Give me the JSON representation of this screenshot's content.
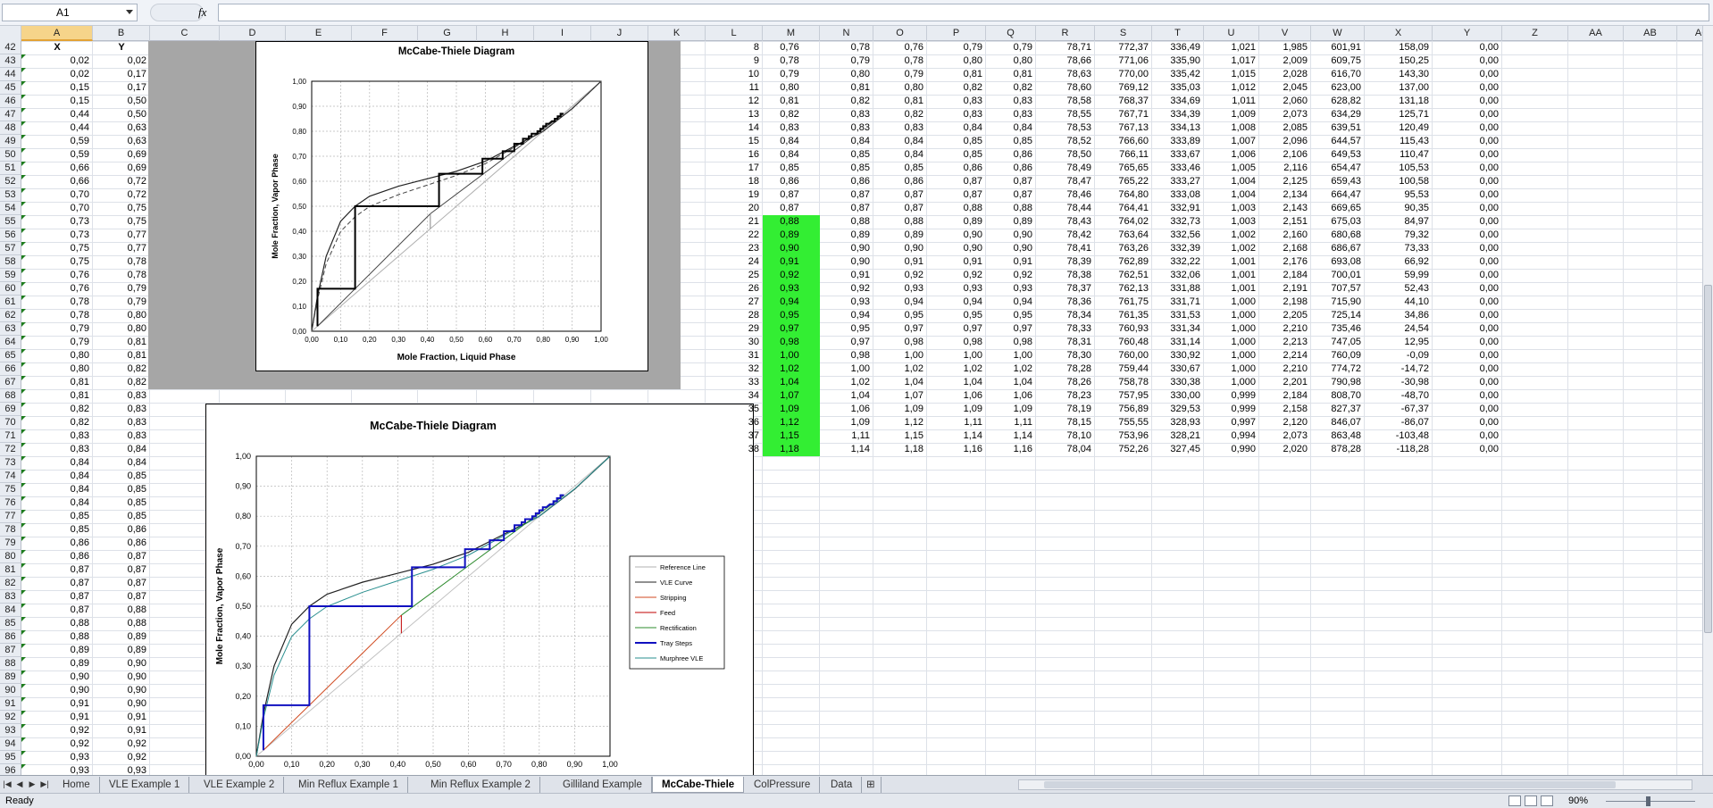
{
  "name_box": "A1",
  "fx": "fx",
  "columns": [
    "A",
    "B",
    "C",
    "D",
    "E",
    "F",
    "G",
    "H",
    "I",
    "J",
    "K",
    "L",
    "M",
    "N",
    "O",
    "P",
    "Q",
    "R",
    "S",
    "T",
    "U",
    "V",
    "W",
    "X",
    "Y",
    "Z",
    "AA",
    "AB",
    "AC"
  ],
  "selected_column": "A",
  "rows_first": 42,
  "header_row": {
    "A": "X",
    "B": "Y"
  },
  "xy": [
    [
      "0,02",
      "0,02"
    ],
    [
      "0,02",
      "0,17"
    ],
    [
      "0,15",
      "0,17"
    ],
    [
      "0,15",
      "0,50"
    ],
    [
      "0,44",
      "0,50"
    ],
    [
      "0,44",
      "0,63"
    ],
    [
      "0,59",
      "0,63"
    ],
    [
      "0,59",
      "0,69"
    ],
    [
      "0,66",
      "0,69"
    ],
    [
      "0,66",
      "0,72"
    ],
    [
      "0,70",
      "0,72"
    ],
    [
      "0,70",
      "0,75"
    ],
    [
      "0,73",
      "0,75"
    ],
    [
      "0,73",
      "0,77"
    ],
    [
      "0,75",
      "0,77"
    ],
    [
      "0,75",
      "0,78"
    ],
    [
      "0,76",
      "0,78"
    ],
    [
      "0,76",
      "0,79"
    ],
    [
      "0,78",
      "0,79"
    ],
    [
      "0,78",
      "0,80"
    ],
    [
      "0,79",
      "0,80"
    ],
    [
      "0,79",
      "0,81"
    ],
    [
      "0,80",
      "0,81"
    ],
    [
      "0,80",
      "0,82"
    ],
    [
      "0,81",
      "0,82"
    ],
    [
      "0,81",
      "0,83"
    ],
    [
      "0,82",
      "0,83"
    ],
    [
      "0,82",
      "0,83"
    ],
    [
      "0,83",
      "0,83"
    ],
    [
      "0,83",
      "0,84"
    ],
    [
      "0,84",
      "0,84"
    ],
    [
      "0,84",
      "0,85"
    ],
    [
      "0,84",
      "0,85"
    ],
    [
      "0,84",
      "0,85"
    ],
    [
      "0,85",
      "0,85"
    ],
    [
      "0,85",
      "0,86"
    ],
    [
      "0,86",
      "0,86"
    ],
    [
      "0,86",
      "0,87"
    ],
    [
      "0,87",
      "0,87"
    ],
    [
      "0,87",
      "0,87"
    ],
    [
      "0,87",
      "0,87"
    ],
    [
      "0,87",
      "0,88"
    ],
    [
      "0,88",
      "0,88"
    ],
    [
      "0,88",
      "0,89"
    ],
    [
      "0,89",
      "0,89"
    ],
    [
      "0,89",
      "0,90"
    ],
    [
      "0,90",
      "0,90"
    ],
    [
      "0,90",
      "0,90"
    ],
    [
      "0,91",
      "0,90"
    ],
    [
      "0,91",
      "0,91"
    ],
    [
      "0,92",
      "0,91"
    ],
    [
      "0,92",
      "0,92"
    ],
    [
      "0,93",
      "0,92"
    ],
    [
      "0,93",
      "0,93"
    ]
  ],
  "table": [
    [
      "8",
      "0,76",
      "0,78",
      "0,76",
      "0,79",
      "0,79",
      "78,71",
      "772,37",
      "336,49",
      "1,021",
      "1,985",
      "601,91",
      "158,09",
      "0,00"
    ],
    [
      "9",
      "0,78",
      "0,79",
      "0,78",
      "0,80",
      "0,80",
      "78,66",
      "771,06",
      "335,90",
      "1,017",
      "2,009",
      "609,75",
      "150,25",
      "0,00"
    ],
    [
      "10",
      "0,79",
      "0,80",
      "0,79",
      "0,81",
      "0,81",
      "78,63",
      "770,00",
      "335,42",
      "1,015",
      "2,028",
      "616,70",
      "143,30",
      "0,00"
    ],
    [
      "11",
      "0,80",
      "0,81",
      "0,80",
      "0,82",
      "0,82",
      "78,60",
      "769,12",
      "335,03",
      "1,012",
      "2,045",
      "623,00",
      "137,00",
      "0,00"
    ],
    [
      "12",
      "0,81",
      "0,82",
      "0,81",
      "0,83",
      "0,83",
      "78,58",
      "768,37",
      "334,69",
      "1,011",
      "2,060",
      "628,82",
      "131,18",
      "0,00"
    ],
    [
      "13",
      "0,82",
      "0,83",
      "0,82",
      "0,83",
      "0,83",
      "78,55",
      "767,71",
      "334,39",
      "1,009",
      "2,073",
      "634,29",
      "125,71",
      "0,00"
    ],
    [
      "14",
      "0,83",
      "0,83",
      "0,83",
      "0,84",
      "0,84",
      "78,53",
      "767,13",
      "334,13",
      "1,008",
      "2,085",
      "639,51",
      "120,49",
      "0,00"
    ],
    [
      "15",
      "0,84",
      "0,84",
      "0,84",
      "0,85",
      "0,85",
      "78,52",
      "766,60",
      "333,89",
      "1,007",
      "2,096",
      "644,57",
      "115,43",
      "0,00"
    ],
    [
      "16",
      "0,84",
      "0,85",
      "0,84",
      "0,85",
      "0,86",
      "78,50",
      "766,11",
      "333,67",
      "1,006",
      "2,106",
      "649,53",
      "110,47",
      "0,00"
    ],
    [
      "17",
      "0,85",
      "0,85",
      "0,85",
      "0,86",
      "0,86",
      "78,49",
      "765,65",
      "333,46",
      "1,005",
      "2,116",
      "654,47",
      "105,53",
      "0,00"
    ],
    [
      "18",
      "0,86",
      "0,86",
      "0,86",
      "0,87",
      "0,87",
      "78,47",
      "765,22",
      "333,27",
      "1,004",
      "2,125",
      "659,43",
      "100,58",
      "0,00"
    ],
    [
      "19",
      "0,87",
      "0,87",
      "0,87",
      "0,87",
      "0,87",
      "78,46",
      "764,80",
      "333,08",
      "1,004",
      "2,134",
      "664,47",
      "95,53",
      "0,00"
    ],
    [
      "20",
      "0,87",
      "0,87",
      "0,87",
      "0,88",
      "0,88",
      "78,44",
      "764,41",
      "332,91",
      "1,003",
      "2,143",
      "669,65",
      "90,35",
      "0,00"
    ],
    [
      "21",
      "0,88",
      "0,88",
      "0,88",
      "0,89",
      "0,89",
      "78,43",
      "764,02",
      "332,73",
      "1,003",
      "2,151",
      "675,03",
      "84,97",
      "0,00"
    ],
    [
      "22",
      "0,89",
      "0,89",
      "0,89",
      "0,90",
      "0,90",
      "78,42",
      "763,64",
      "332,56",
      "1,002",
      "2,160",
      "680,68",
      "79,32",
      "0,00"
    ],
    [
      "23",
      "0,90",
      "0,90",
      "0,90",
      "0,90",
      "0,90",
      "78,41",
      "763,26",
      "332,39",
      "1,002",
      "2,168",
      "686,67",
      "73,33",
      "0,00"
    ],
    [
      "24",
      "0,91",
      "0,90",
      "0,91",
      "0,91",
      "0,91",
      "78,39",
      "762,89",
      "332,22",
      "1,001",
      "2,176",
      "693,08",
      "66,92",
      "0,00"
    ],
    [
      "25",
      "0,92",
      "0,91",
      "0,92",
      "0,92",
      "0,92",
      "78,38",
      "762,51",
      "332,06",
      "1,001",
      "2,184",
      "700,01",
      "59,99",
      "0,00"
    ],
    [
      "26",
      "0,93",
      "0,92",
      "0,93",
      "0,93",
      "0,93",
      "78,37",
      "762,13",
      "331,88",
      "1,001",
      "2,191",
      "707,57",
      "52,43",
      "0,00"
    ],
    [
      "27",
      "0,94",
      "0,93",
      "0,94",
      "0,94",
      "0,94",
      "78,36",
      "761,75",
      "331,71",
      "1,000",
      "2,198",
      "715,90",
      "44,10",
      "0,00"
    ],
    [
      "28",
      "0,95",
      "0,94",
      "0,95",
      "0,95",
      "0,95",
      "78,34",
      "761,35",
      "331,53",
      "1,000",
      "2,205",
      "725,14",
      "34,86",
      "0,00"
    ],
    [
      "29",
      "0,97",
      "0,95",
      "0,97",
      "0,97",
      "0,97",
      "78,33",
      "760,93",
      "331,34",
      "1,000",
      "2,210",
      "735,46",
      "24,54",
      "0,00"
    ],
    [
      "30",
      "0,98",
      "0,97",
      "0,98",
      "0,98",
      "0,98",
      "78,31",
      "760,48",
      "331,14",
      "1,000",
      "2,213",
      "747,05",
      "12,95",
      "0,00"
    ],
    [
      "31",
      "1,00",
      "0,98",
      "1,00",
      "1,00",
      "1,00",
      "78,30",
      "760,00",
      "330,92",
      "1,000",
      "2,214",
      "760,09",
      "-0,09",
      "0,00"
    ],
    [
      "32",
      "1,02",
      "1,00",
      "1,02",
      "1,02",
      "1,02",
      "78,28",
      "759,44",
      "330,67",
      "1,000",
      "2,210",
      "774,72",
      "-14,72",
      "0,00"
    ],
    [
      "33",
      "1,04",
      "1,02",
      "1,04",
      "1,04",
      "1,04",
      "78,26",
      "758,78",
      "330,38",
      "1,000",
      "2,201",
      "790,98",
      "-30,98",
      "0,00"
    ],
    [
      "34",
      "1,07",
      "1,04",
      "1,07",
      "1,06",
      "1,06",
      "78,23",
      "757,95",
      "330,00",
      "0,999",
      "2,184",
      "808,70",
      "-48,70",
      "0,00"
    ],
    [
      "35",
      "1,09",
      "1,06",
      "1,09",
      "1,09",
      "1,09",
      "78,19",
      "756,89",
      "329,53",
      "0,999",
      "2,158",
      "827,37",
      "-67,37",
      "0,00"
    ],
    [
      "36",
      "1,12",
      "1,09",
      "1,12",
      "1,11",
      "1,11",
      "78,15",
      "755,55",
      "328,93",
      "0,997",
      "2,120",
      "846,07",
      "-86,07",
      "0,00"
    ],
    [
      "37",
      "1,15",
      "1,11",
      "1,15",
      "1,14",
      "1,14",
      "78,10",
      "753,96",
      "328,21",
      "0,994",
      "2,073",
      "863,48",
      "-103,48",
      "0,00"
    ],
    [
      "38",
      "1,18",
      "1,14",
      "1,18",
      "1,16",
      "1,16",
      "78,04",
      "752,26",
      "327,45",
      "0,990",
      "2,020",
      "878,28",
      "-118,28",
      "0,00"
    ]
  ],
  "green_rows_from": 13,
  "chart1": {
    "title": "McCabe-Thiele Diagram",
    "xlabel": "Mole Fraction, Liquid Phase",
    "ylabel": "Mole Fraction, Vapor Phase"
  },
  "chart2": {
    "title": "McCabe-Thiele  Diagram",
    "ylabel": "Mole Fraction, Vapor Phase",
    "legend": [
      {
        "name": "Reference Line",
        "color": "#b0b0b0"
      },
      {
        "name": "VLE Curve",
        "color": "#222222"
      },
      {
        "name": "Stripping",
        "color": "#d04a20"
      },
      {
        "name": "Feed",
        "color": "#c00000"
      },
      {
        "name": "Rectification",
        "color": "#2e8b2e"
      },
      {
        "name": "Tray Steps",
        "color": "#1010c0"
      },
      {
        "name": "Murphree VLE",
        "color": "#2a8f8f"
      }
    ]
  },
  "chart_data": [
    {
      "type": "line",
      "title": "McCabe-Thiele Diagram",
      "xlabel": "Mole Fraction, Liquid Phase",
      "ylabel": "Mole Fraction, Vapor Phase",
      "xlim": [
        0,
        1
      ],
      "ylim": [
        0,
        1
      ],
      "ticks": [
        "0,00",
        "0,10",
        "0,20",
        "0,30",
        "0,40",
        "0,50",
        "0,60",
        "0,70",
        "0,80",
        "0,90",
        "1,00"
      ],
      "vle": [
        [
          0,
          0
        ],
        [
          0.02,
          0.14
        ],
        [
          0.05,
          0.3
        ],
        [
          0.1,
          0.44
        ],
        [
          0.15,
          0.5
        ],
        [
          0.2,
          0.54
        ],
        [
          0.3,
          0.58
        ],
        [
          0.4,
          0.61
        ],
        [
          0.5,
          0.64
        ],
        [
          0.6,
          0.68
        ],
        [
          0.7,
          0.74
        ],
        [
          0.8,
          0.8
        ],
        [
          0.9,
          0.89
        ],
        [
          1,
          1
        ]
      ],
      "steps": [
        [
          0.02,
          0.02
        ],
        [
          0.02,
          0.17
        ],
        [
          0.15,
          0.17
        ],
        [
          0.15,
          0.5
        ],
        [
          0.44,
          0.5
        ],
        [
          0.44,
          0.63
        ],
        [
          0.59,
          0.63
        ],
        [
          0.59,
          0.69
        ],
        [
          0.66,
          0.69
        ],
        [
          0.66,
          0.72
        ],
        [
          0.7,
          0.72
        ],
        [
          0.7,
          0.75
        ],
        [
          0.73,
          0.75
        ],
        [
          0.73,
          0.77
        ],
        [
          0.75,
          0.77
        ],
        [
          0.75,
          0.78
        ],
        [
          0.76,
          0.78
        ],
        [
          0.76,
          0.79
        ],
        [
          0.78,
          0.79
        ],
        [
          0.78,
          0.8
        ],
        [
          0.79,
          0.8
        ],
        [
          0.79,
          0.81
        ],
        [
          0.8,
          0.81
        ],
        [
          0.8,
          0.82
        ],
        [
          0.81,
          0.82
        ],
        [
          0.81,
          0.83
        ],
        [
          0.82,
          0.83
        ],
        [
          0.83,
          0.84
        ],
        [
          0.84,
          0.84
        ],
        [
          0.84,
          0.85
        ],
        [
          0.85,
          0.85
        ],
        [
          0.85,
          0.86
        ],
        [
          0.86,
          0.86
        ],
        [
          0.86,
          0.87
        ],
        [
          0.87,
          0.87
        ]
      ]
    },
    {
      "type": "line",
      "title": "McCabe-Thiele  Diagram",
      "ylabel": "Mole Fraction, Vapor Phase",
      "xlim": [
        0,
        1
      ],
      "ylim": [
        0,
        1
      ],
      "series": [
        "Reference Line",
        "VLE Curve",
        "Stripping",
        "Feed",
        "Rectification",
        "Tray Steps",
        "Murphree VLE"
      ]
    }
  ]
}
